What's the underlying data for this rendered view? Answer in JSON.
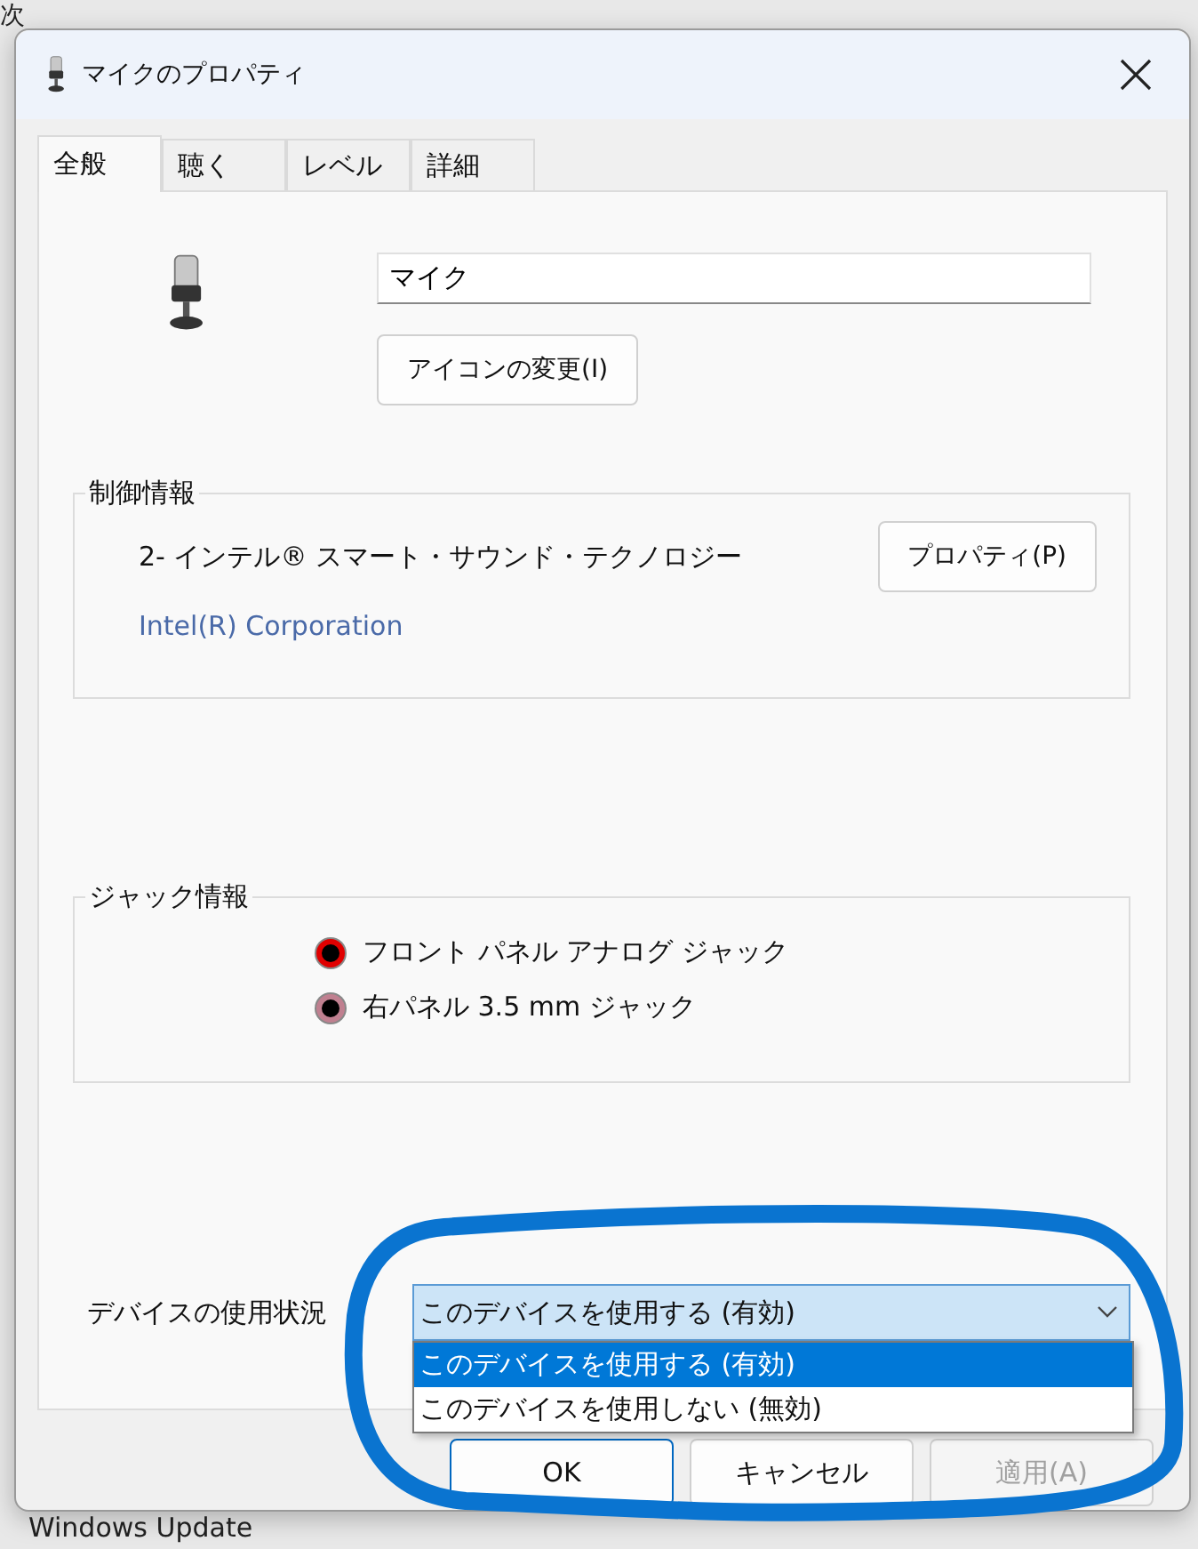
{
  "background": {
    "top_text": "次",
    "bottom_text": "Windows Update"
  },
  "dialog": {
    "title": "マイクのプロパティ",
    "tabs": [
      {
        "label": "全般",
        "selected": true
      },
      {
        "label": "聴く",
        "selected": false
      },
      {
        "label": "レベル",
        "selected": false
      },
      {
        "label": "詳細",
        "selected": false
      }
    ],
    "device_name": {
      "value": "マイク"
    },
    "change_icon_button": "アイコンの変更(I)",
    "controller": {
      "legend": "制御情報",
      "name": "2- インテル® スマート・サウンド・テクノロジー",
      "vendor": "Intel(R) Corporation",
      "button": "プロパティ(P)"
    },
    "jacks": {
      "legend": "ジャック情報",
      "items": [
        {
          "label": "フロント パネル アナログ ジャック",
          "color": "#e00000"
        },
        {
          "label": "右パネル 3.5 mm ジャック",
          "color": "#c08090"
        }
      ]
    },
    "device_usage": {
      "label": "デバイスの使用状況",
      "value": "このデバイスを使用する (有効)",
      "expanded": true,
      "options": [
        {
          "label": "このデバイスを使用する (有効)",
          "selected": true
        },
        {
          "label": "このデバイスを使用しない (無効)",
          "selected": false
        }
      ]
    },
    "buttons": [
      {
        "label": "OK",
        "default": true,
        "disabled": false
      },
      {
        "label": "キャンセル",
        "default": false,
        "disabled": false
      },
      {
        "label": "適用(A)",
        "default": false,
        "disabled": true
      }
    ]
  }
}
